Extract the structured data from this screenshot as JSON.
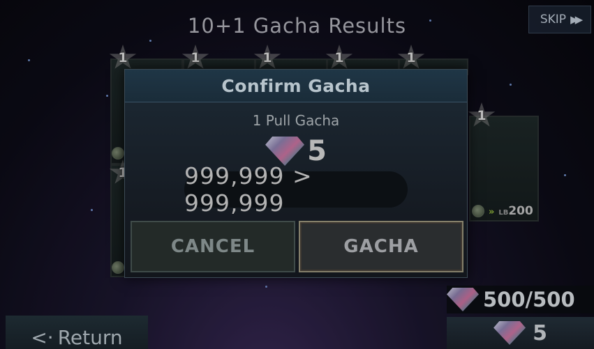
{
  "header": {
    "title": "10+1 Gacha Results",
    "skip_label": "SKIP",
    "skip_arrows": "▶▶"
  },
  "cards": {
    "rarity_label": "1",
    "limit_break_prefix": "LB",
    "limit_break_value": "200",
    "limit_break_chevron": "»"
  },
  "dialog": {
    "title": "Confirm Gacha",
    "pull_label": "1 Pull Gacha",
    "cost": "5",
    "balance": "999,999 > 999,999",
    "cancel_label": "CANCEL",
    "confirm_label": "GACHA"
  },
  "footer": {
    "gem_total": "500/500",
    "pull_cost": "5",
    "return_label": "Return",
    "return_arrow": "<·"
  },
  "colors": {
    "background": "#0d0c18",
    "dialog_header": "#1f3646",
    "gacha_button_border": "#85806a",
    "cancel_button_border": "#3f4b49"
  }
}
